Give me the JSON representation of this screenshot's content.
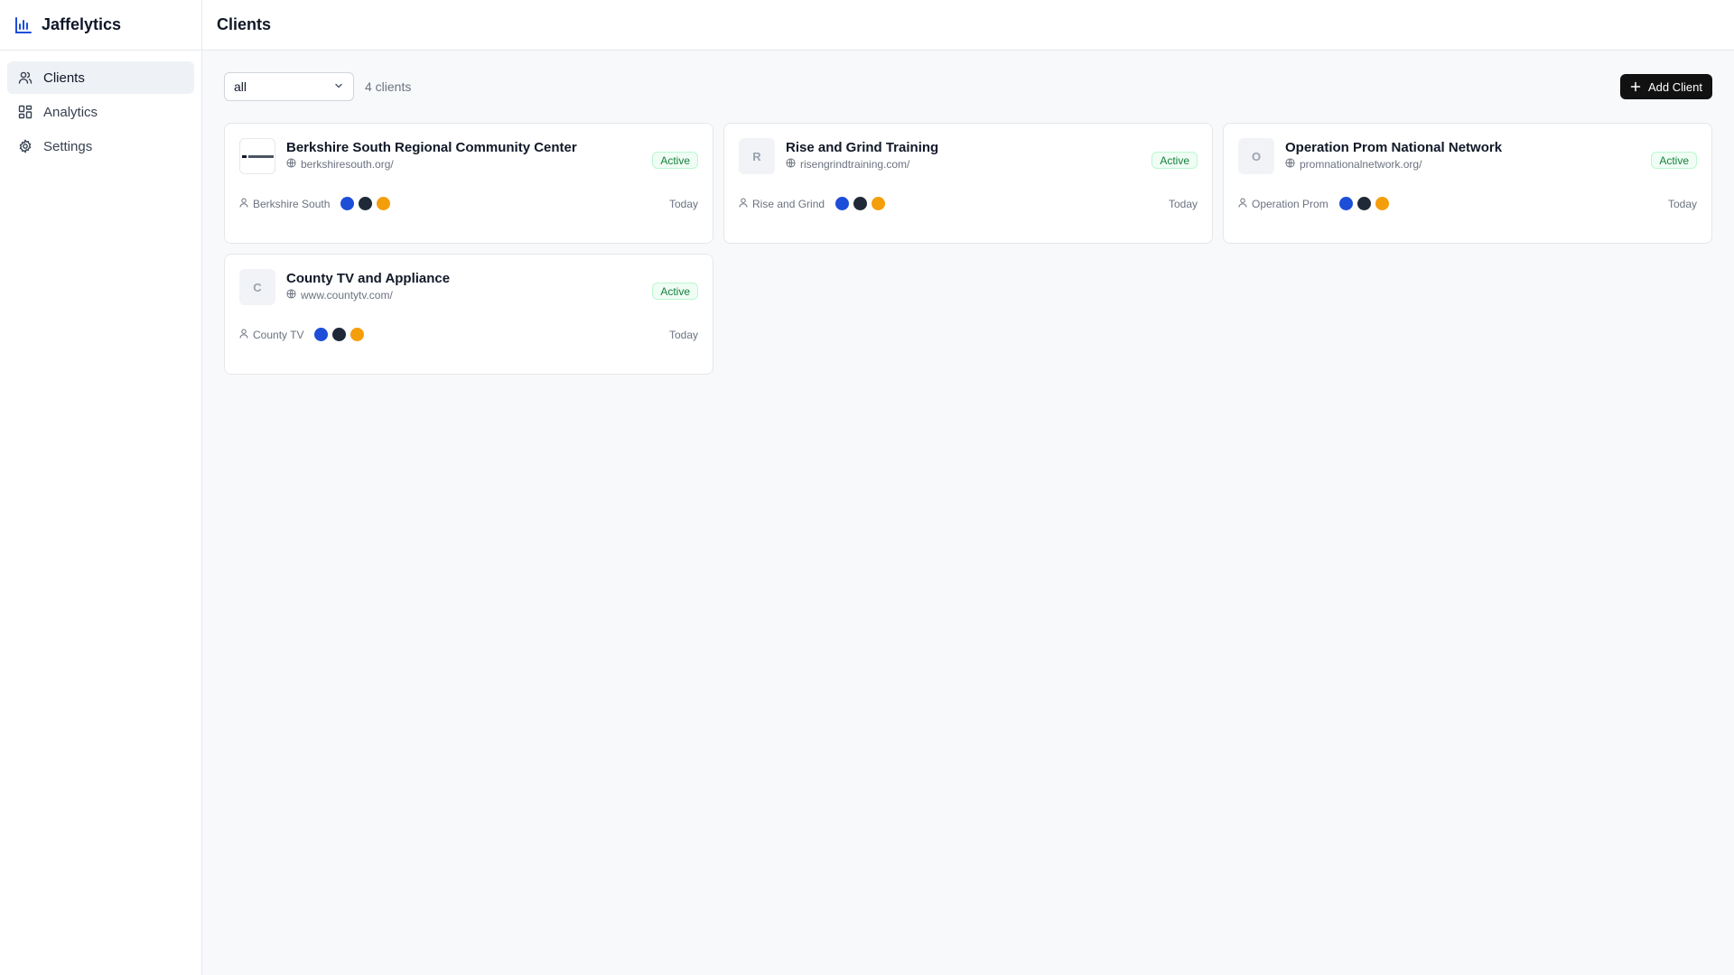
{
  "app": {
    "name": "Jaffelytics"
  },
  "sidebar": {
    "items": [
      {
        "label": "Clients",
        "icon": "users-icon",
        "active": true
      },
      {
        "label": "Analytics",
        "icon": "grid-icon",
        "active": false
      },
      {
        "label": "Settings",
        "icon": "gear-icon",
        "active": false
      }
    ]
  },
  "header": {
    "title": "Clients"
  },
  "toolbar": {
    "filter_value": "all",
    "count_text": "4 clients",
    "add_label": "Add Client"
  },
  "clients": [
    {
      "name": "Berkshire South Regional Community Center",
      "initial": "",
      "url": "berkshiresouth.org/",
      "status": "Active",
      "contact": "Berkshire South",
      "date": "Today",
      "colors": [
        "#1d4ed8",
        "#1f2937",
        "#f59e0b"
      ]
    },
    {
      "name": "Rise and Grind Training",
      "initial": "R",
      "url": "risengrindtraining.com/",
      "status": "Active",
      "contact": "Rise and Grind",
      "date": "Today",
      "colors": [
        "#1d4ed8",
        "#1f2937",
        "#f59e0b"
      ]
    },
    {
      "name": "Operation Prom National Network",
      "initial": "O",
      "url": "promnationalnetwork.org/",
      "status": "Active",
      "contact": "Operation Prom",
      "date": "Today",
      "colors": [
        "#1d4ed8",
        "#1f2937",
        "#f59e0b"
      ]
    },
    {
      "name": "County TV and Appliance",
      "initial": "C",
      "url": "www.countytv.com/",
      "status": "Active",
      "contact": "County TV",
      "date": "Today",
      "colors": [
        "#1d4ed8",
        "#1f2937",
        "#f59e0b"
      ]
    }
  ]
}
